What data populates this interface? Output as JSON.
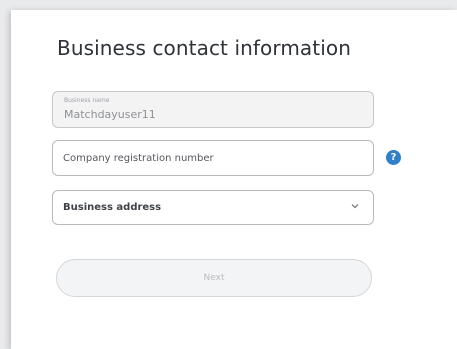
{
  "form": {
    "title": "Business contact information",
    "business_name": {
      "label": "Business name",
      "value": "Matchdayuser11"
    },
    "registration": {
      "placeholder": "Company registration number",
      "help_icon": "question-icon",
      "help_symbol": "?"
    },
    "address": {
      "label": "Business address",
      "icon": "chevron-down-icon"
    },
    "next_label": "Next"
  },
  "colors": {
    "accent": "#2f7fc9",
    "title": "#2f3238",
    "disabled_text": "#b9bcc0"
  }
}
